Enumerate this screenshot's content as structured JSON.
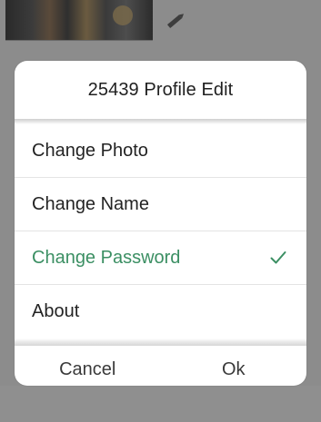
{
  "dialog": {
    "title": "25439 Profile Edit",
    "options": [
      {
        "label": "Change Photo",
        "selected": false
      },
      {
        "label": "Change Name",
        "selected": false
      },
      {
        "label": "Change Password",
        "selected": true
      },
      {
        "label": "About",
        "selected": false
      }
    ],
    "selected_icon": "checkmark-icon",
    "cancel_label": "Cancel",
    "ok_label": "Ok"
  },
  "background": {
    "edit_icon": "pencil-icon"
  },
  "colors": {
    "selected_text": "#3b8f63",
    "overlay": "#8c8c8c",
    "dialog_bg": "#ffffff"
  }
}
